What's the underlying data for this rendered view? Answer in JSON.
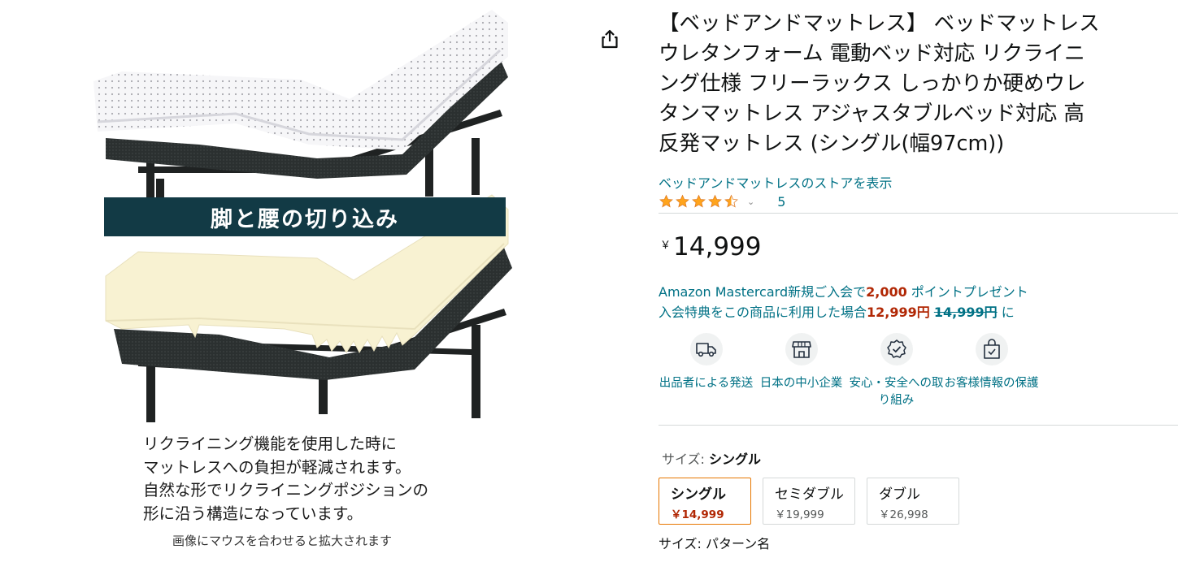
{
  "image_panel": {
    "banner_text": "脚と腰の切り込み",
    "caption_lines": [
      "リクライニング機能を使用した時に",
      "マットレスへの負担が軽減されます。",
      "自然な形でリクライニングポジションの",
      "形に沿う構造になっています。"
    ],
    "zoom_hint": "画像にマウスを合わせると拡大されます"
  },
  "product": {
    "title_lines": [
      "【ベッドアンドマットレス】 ベッドマットレス",
      "ウレタンフォーム 電動ベッド対応 リクライニ",
      "ング仕様 フリーラックス しっかりか硬めウレ",
      "タンマットレス アジャスタブルベッド対応 高",
      "反発マットレス (シングル(幅97cm))"
    ],
    "store_link": "ベッドアンドマットレスのストアを表示",
    "rating": 4.5,
    "rating_count": "5",
    "price_symbol": "￥",
    "price_whole": "14,999"
  },
  "promo": {
    "line1_prefix": "Amazon Mastercard新規ご入会で",
    "line1_points": "2,000",
    "line1_suffix": " ポイントプレゼント",
    "line2_prefix": "入会特典をこの商品に利用した場合",
    "line2_price": "12,999円",
    "line2_strike": "14,999円",
    "line2_suffix": " に"
  },
  "badges": [
    {
      "icon": "delivery-truck-icon",
      "label": "出品者による発送"
    },
    {
      "icon": "store-icon",
      "label": "日本の中小企業"
    },
    {
      "icon": "shield-badge-icon",
      "label": "安心・安全への取り組み"
    },
    {
      "icon": "secure-bag-icon",
      "label": "お客様情報の保護"
    }
  ],
  "size": {
    "label": "サイズ:",
    "selected": "シングル",
    "options": [
      {
        "name": "シングル",
        "price": "￥14,999"
      },
      {
        "name": "セミダブル",
        "price": "￥19,999"
      },
      {
        "name": "ダブル",
        "price": "￥26,998"
      }
    ]
  },
  "cut_text": "サイズ: パターン名",
  "colors": {
    "link": "#007185",
    "price_red": "#b12704",
    "star": "#ffa41c",
    "selected_border": "#e77600",
    "banner": "#123a45"
  }
}
